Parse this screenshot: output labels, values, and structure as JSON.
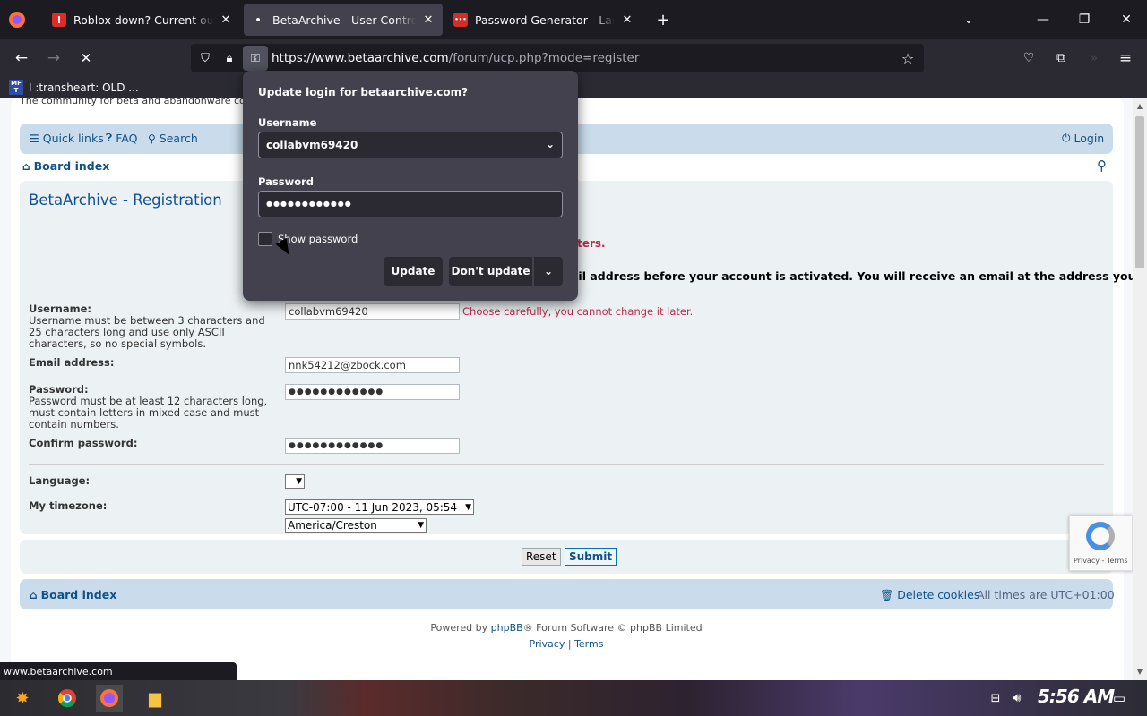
{
  "tabs": [
    {
      "title": "Roblox down? Current outages",
      "favicon_text": "!",
      "favicon_color": "#e02b2b",
      "active": false
    },
    {
      "title": "BetaArchive - User Control Panel",
      "favicon_text": "•",
      "favicon_color": "#42414d",
      "active": true
    },
    {
      "title": "Password Generator - LastPass",
      "favicon_text": "•••",
      "favicon_color": "#d32d27",
      "active": false
    }
  ],
  "url": {
    "host": "https://www.betaarchive.com",
    "path": "/forum/ucp.php?mode=register"
  },
  "bookmark": {
    "icon_text": "MF T",
    "label": "I :transheart: OLD ..."
  },
  "site": {
    "tagline": "The community for beta and abandonware co",
    "quick_links": "Quick links",
    "faq": "FAQ",
    "search": "Search",
    "login": "Login",
    "board_index": "Board index"
  },
  "registration": {
    "title": "BetaArchive - Registration",
    "error_partial": "cters.",
    "notice_partial": "ail address before your account is activated. You will receive an email at the address you",
    "username_label": "Username:",
    "username_help": "Username must be between 3 characters and 25 characters long and use only ASCII characters, so no special symbols.",
    "username_value": "collabvm69420",
    "username_warning": "Choose carefully, you cannot change it later.",
    "email_label": "Email address:",
    "email_value": "nnk54212@zbock.com",
    "password_label": "Password:",
    "password_help": "Password must be at least 12 characters long, must contain letters in mixed case and must contain numbers.",
    "password_value": "●●●●●●●●●●●●",
    "confirm_label": "Confirm password:",
    "confirm_value": "●●●●●●●●●●●●",
    "language_label": "Language:",
    "timezone_label": "My timezone:",
    "timezone_value": "UTC-07:00 - 11 Jun 2023, 05:54",
    "region_value": "America/Creston",
    "reset": "Reset",
    "submit": "Submit"
  },
  "footer": {
    "board_index": "Board index",
    "delete_cookies": "Delete cookies",
    "times": "All times are UTC+01:00",
    "powered_prefix": "Powered by ",
    "phpbb": "phpBB",
    "powered_suffix": "® Forum Software © phpBB Limited",
    "privacy": "Privacy",
    "sep": "|",
    "terms": "Terms"
  },
  "recaptcha": {
    "links": "Privacy - Terms"
  },
  "status_bar": "www.betaarchive.com",
  "clock": "5:56 AM",
  "password_popup": {
    "title": "Update login for betaarchive.com?",
    "username_label": "Username",
    "username_value": "collabvm69420",
    "password_label": "Password",
    "password_value": "●●●●●●●●●●●●",
    "show_password": "Show password",
    "update": "Update",
    "dont_update": "Don't update"
  }
}
